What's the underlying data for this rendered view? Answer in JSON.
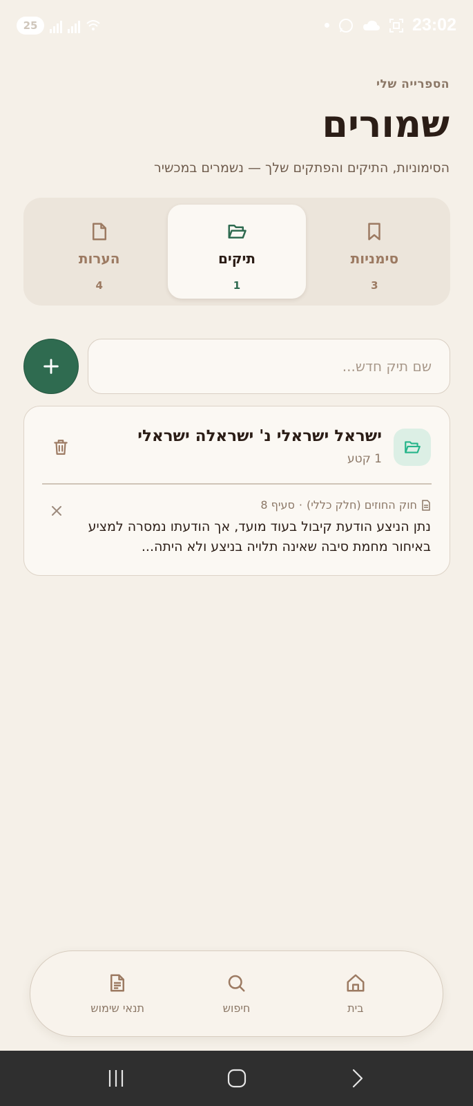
{
  "status_bar": {
    "badge": "25",
    "time": "23:02"
  },
  "header": {
    "eyebrow": "הספרייה שלי",
    "title": "שמורים",
    "subtitle": "הסימוניות, התיקים והפתקים שלך — נשמרים במכשיר"
  },
  "tabs": [
    {
      "label": "סימניות",
      "count": "3",
      "icon": "bookmark-icon",
      "active": false
    },
    {
      "label": "תיקים",
      "count": "1",
      "icon": "folder-open-icon",
      "active": true
    },
    {
      "label": "הערות",
      "count": "4",
      "icon": "note-icon",
      "active": false
    }
  ],
  "new_folder": {
    "placeholder": "שם תיק חדש..."
  },
  "folder": {
    "name": "ישראל ישראלי נ' ישראלה ישראלי",
    "meta": "1 קטע",
    "item": {
      "source_prefix": "חוק החוזים (חלק כללי)",
      "separator": "·",
      "section": "סעיף 8",
      "text": "נתן הניצע הודעת קיבול בעוד מועד, אך הודעתו נמסרה למציע באיחור מחמת סיבה שאינה תלויה בניצע ולא היתה..."
    }
  },
  "bottom_nav": [
    {
      "label": "בית",
      "icon": "home-icon"
    },
    {
      "label": "חיפוש",
      "icon": "search-icon"
    },
    {
      "label": "תנאי שימוש",
      "icon": "document-icon"
    }
  ],
  "colors": {
    "background": "#f5f0e8",
    "accent": "#2f6b50",
    "muted": "#8b7766",
    "text": "#2b1d16"
  }
}
